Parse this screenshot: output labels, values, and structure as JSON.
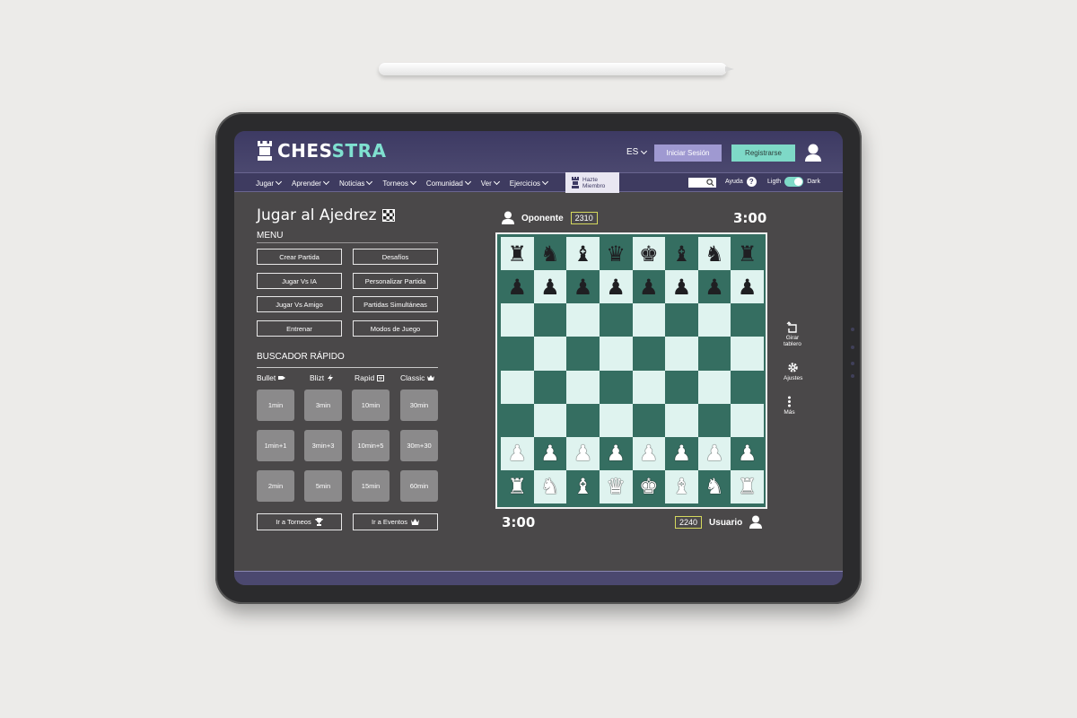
{
  "brand": {
    "name_part1": "CHES",
    "name_part2": "STRA"
  },
  "header": {
    "language": "ES",
    "login_label": "Iniciar Sesión",
    "register_label": "Registrarse"
  },
  "nav": {
    "items": [
      {
        "label": "Jugar"
      },
      {
        "label": "Aprender"
      },
      {
        "label": "Noticias"
      },
      {
        "label": "Torneos"
      },
      {
        "label": "Comunidad"
      },
      {
        "label": "Ver"
      },
      {
        "label": "Ejercicios"
      }
    ],
    "member_line1": "Hazte",
    "member_line2": "Miembro",
    "help_label": "Ayuda",
    "theme_light": "Ligth",
    "theme_dark": "Dark"
  },
  "page": {
    "title": "Jugar al Ajedrez",
    "menu_title": "MENU",
    "menu_buttons": [
      "Crear Partida",
      "Desafíos",
      "Jugar Vs IA",
      "Personalizar Partida",
      "Jugar Vs Amigo",
      "Partidas Simultáneas",
      "Entrenar",
      "Modos de Juego"
    ],
    "quick_title": "BUSCADOR RÁPIDO",
    "modes": [
      "Bullet",
      "Blizt",
      "Rapid",
      "Classic"
    ],
    "time_controls": [
      [
        "1min",
        "3min",
        "10min",
        "30min"
      ],
      [
        "1min+1",
        "3min+3",
        "10min+5",
        "30m+30"
      ],
      [
        "2min",
        "5min",
        "15min",
        "60min"
      ]
    ],
    "tournaments_label": "Ir a Torneos",
    "events_label": "Ir a Eventos"
  },
  "game": {
    "opponent": {
      "name": "Oponente",
      "rating": "2310",
      "clock": "3:00"
    },
    "user": {
      "name": "Usuario",
      "rating": "2240",
      "clock": "3:00"
    },
    "board": [
      [
        "♜",
        "♞",
        "♝",
        "♛",
        "♚",
        "♝",
        "♞",
        "♜"
      ],
      [
        "♟",
        "♟",
        "♟",
        "♟",
        "♟",
        "♟",
        "♟",
        "♟"
      ],
      [
        "",
        "",
        "",
        "",
        "",
        "",
        "",
        ""
      ],
      [
        "",
        "",
        "",
        "",
        "",
        "",
        "",
        ""
      ],
      [
        "",
        "",
        "",
        "",
        "",
        "",
        "",
        ""
      ],
      [
        "",
        "",
        "",
        "",
        "",
        "",
        "",
        ""
      ],
      [
        "♙",
        "♙",
        "♙",
        "♙",
        "♙",
        "♙",
        "♙",
        "♙"
      ],
      [
        "♖",
        "♘",
        "♗",
        "♕",
        "♔",
        "♗",
        "♘",
        "♖"
      ]
    ]
  },
  "sidebar_tools": {
    "flip_line1": "Girar",
    "flip_line2": "tablero",
    "settings": "Ajustes",
    "more": "Más"
  },
  "colors": {
    "accent_teal": "#7ed9c7",
    "accent_purple": "#9f99d1",
    "header_bg": "#3d3a63",
    "board_dark": "#356e61",
    "board_light": "#dff3ef"
  }
}
